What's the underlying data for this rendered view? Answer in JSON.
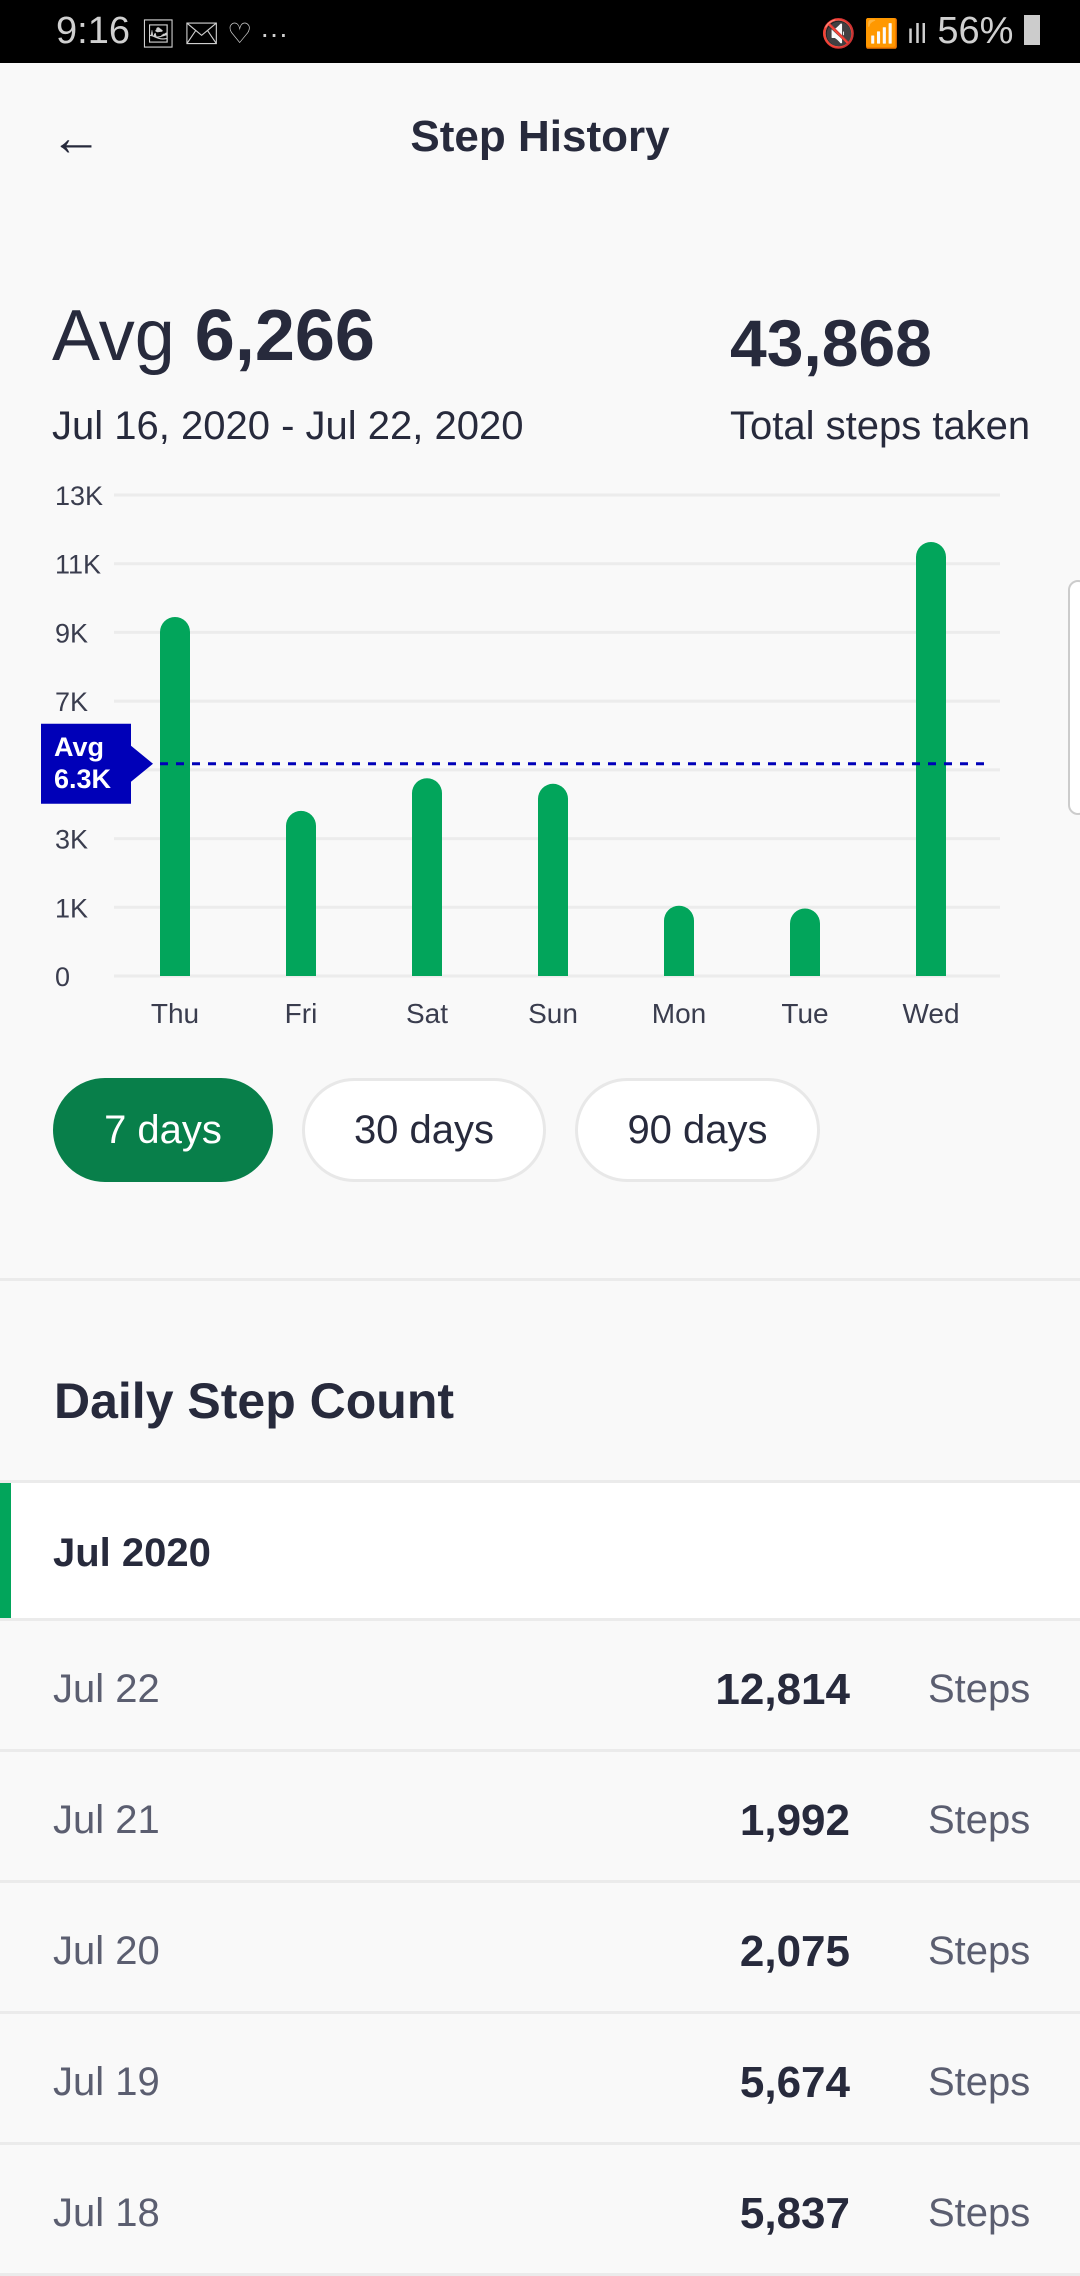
{
  "status_bar": {
    "time": "9:16",
    "left_icons": "🖼 ✉ ♡ ···",
    "right_icons": "🔇 📶 ıll",
    "battery": "56%"
  },
  "header": {
    "title": "Step History",
    "back_icon": "arrow-left-icon"
  },
  "summary": {
    "avg_prefix": "Avg",
    "avg_value": "6,266",
    "date_range": "Jul 16, 2020 - Jul 22, 2020",
    "total_value": "43,868",
    "total_label": "Total steps taken"
  },
  "chart_data": {
    "type": "bar",
    "categories": [
      "Thu",
      "Fri",
      "Sat",
      "Sun",
      "Mon",
      "Tue",
      "Wed"
    ],
    "values": [
      10600,
      4876,
      5837,
      5674,
      2075,
      1992,
      12814
    ],
    "ytick_labels": [
      "0",
      "1K",
      "3K",
      "",
      "7K",
      "9K",
      "11K",
      "13K"
    ],
    "ylim": [
      0,
      14200
    ],
    "grid": true,
    "average": {
      "value": 6266,
      "label_line1": "Avg",
      "label_line2": "6.3K",
      "color": "#0000b8"
    },
    "bar_color": "#02a55b"
  },
  "range_buttons": [
    {
      "label": "7 days",
      "selected": true
    },
    {
      "label": "30 days",
      "selected": false
    },
    {
      "label": "90 days",
      "selected": false
    }
  ],
  "daily": {
    "title": "Daily Step Count",
    "month": "Jul 2020",
    "unit": "Steps",
    "rows": [
      {
        "date": "Jul 22",
        "steps": "12,814"
      },
      {
        "date": "Jul 21",
        "steps": "1,992"
      },
      {
        "date": "Jul 20",
        "steps": "2,075"
      },
      {
        "date": "Jul 19",
        "steps": "5,674"
      },
      {
        "date": "Jul 18",
        "steps": "5,837"
      }
    ]
  }
}
